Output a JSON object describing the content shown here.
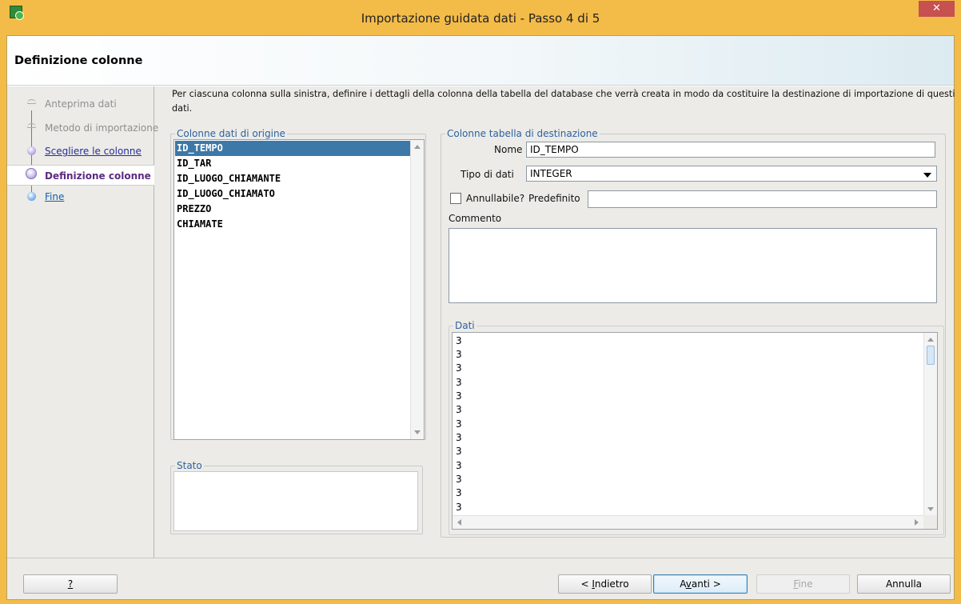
{
  "window": {
    "title": "Importazione guidata dati - Passo 4 di 5",
    "close_glyph": "✕"
  },
  "header": {
    "title": "Definizione colonne"
  },
  "steps": [
    {
      "label": "Anteprima dati",
      "state": "disabled"
    },
    {
      "label": "Metodo di importazione",
      "state": "disabled"
    },
    {
      "label": "Scegliere le colonne",
      "state": "link"
    },
    {
      "label": "Definizione colonne",
      "state": "current"
    },
    {
      "label": "Fine",
      "state": "link"
    }
  ],
  "instructions": {
    "line1": "Per ciascuna colonna sulla sinistra, definire i dettagli della colonna della tabella del database che verrà creata in modo da costituire la destinazione di importazione di questi",
    "line2": "dati."
  },
  "source_columns": {
    "legend": "Colonne dati di origine",
    "items": [
      "ID_TEMPO",
      "ID_TAR",
      "ID_LUOGO_CHIAMANTE",
      "ID_LUOGO_CHIAMATO",
      "PREZZO",
      "CHIAMATE"
    ],
    "selected": "ID_TEMPO"
  },
  "stato": {
    "legend": "Stato"
  },
  "dest_columns": {
    "legend": "Colonne tabella di destinazione",
    "nome_label": "Nome",
    "nome_value": "ID_TEMPO",
    "tipo_label": "Tipo di dati",
    "tipo_value": "INTEGER",
    "annullabile_label": "Annullabile?",
    "annullabile_checked": false,
    "predefinito_label": "Predefinito",
    "predefinito_value": "",
    "commento_label": "Commento",
    "commento_value": ""
  },
  "dati": {
    "legend": "Dati",
    "rows": [
      "3",
      "3",
      "3",
      "3",
      "3",
      "3",
      "3",
      "3",
      "3",
      "3",
      "3",
      "3",
      "3"
    ]
  },
  "buttons": {
    "help": "?",
    "back_prefix": "< ",
    "back_underlined": "I",
    "back_rest": "ndietro",
    "next_prefix": "A",
    "next_underlined": "v",
    "next_rest": "anti >",
    "finish_underlined": "F",
    "finish_rest": "ine",
    "cancel": "Annulla"
  }
}
